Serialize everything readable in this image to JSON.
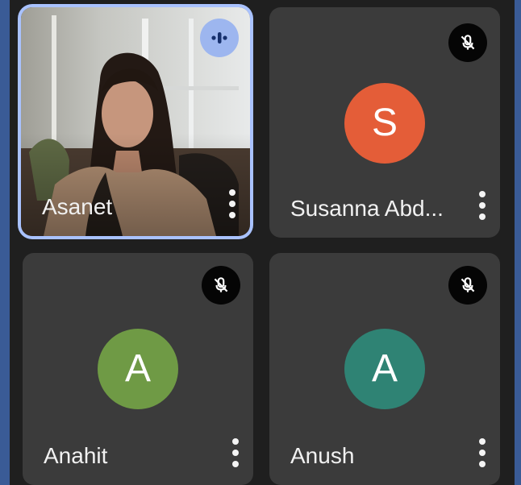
{
  "participants": [
    {
      "name": "Asanet",
      "state": "speaking",
      "icon": "speaking-indicator-icon"
    },
    {
      "name": "Susanna Abd...",
      "initial": "S",
      "avatar_color": "#e45d38",
      "state": "muted",
      "icon": "mic-off-icon"
    },
    {
      "name": "Anahit",
      "initial": "A",
      "avatar_color": "#6f9a45",
      "state": "muted",
      "icon": "mic-off-icon"
    },
    {
      "name": "Anush",
      "initial": "A",
      "avatar_color": "#2f8374",
      "state": "muted",
      "icon": "mic-off-icon"
    }
  ],
  "colors": {
    "background": "#1f1f1f",
    "tile": "#3b3b3b",
    "active_ring": "#a9c2ff"
  },
  "menu_icon": "more-vert-icon"
}
